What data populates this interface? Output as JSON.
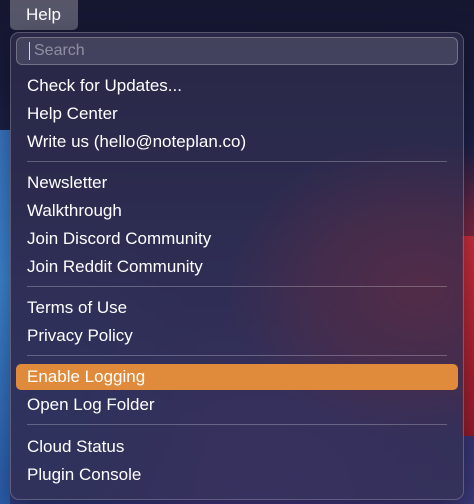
{
  "menubar": {
    "title": "Help"
  },
  "search": {
    "placeholder": "Search",
    "value": ""
  },
  "groups": [
    {
      "items": [
        "Check for Updates...",
        "Help Center",
        "Write us (hello@noteplan.co)"
      ]
    },
    {
      "items": [
        "Newsletter",
        "Walkthrough",
        "Join Discord Community",
        "Join Reddit Community"
      ]
    },
    {
      "items": [
        "Terms of Use",
        "Privacy Policy"
      ]
    },
    {
      "items": [
        "Enable Logging",
        "Open Log Folder"
      ]
    },
    {
      "items": [
        "Cloud Status",
        "Plugin Console"
      ]
    }
  ],
  "highlighted_item": "Enable Logging",
  "colors": {
    "highlight": "#e08b3b",
    "menu_background": "#302e4e",
    "text": "#ffffff"
  }
}
